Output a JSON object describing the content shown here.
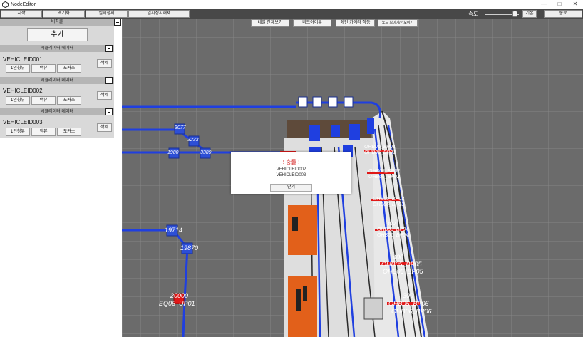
{
  "window": {
    "title": "NodeEditor",
    "controls": {
      "minimize": "—",
      "maximize": "□",
      "close": "✕"
    }
  },
  "menu": {
    "start": "시작",
    "reset": "초기화",
    "pause": "일시정지",
    "resume": "일시정지해제",
    "speed_label": "속도",
    "speed_level": 0.9,
    "default": "기본",
    "exit": "종료"
  },
  "left_panel": {
    "header": "비히클",
    "add": "추가",
    "vehicles": [
      {
        "section": "시뮬레이터 데이터",
        "id": "VEHICLEID001",
        "first_person": "1인칭뷰",
        "back_view": "백뷰",
        "focus": "포커스",
        "delete": "삭제"
      },
      {
        "section": "시뮬레이터 데이터",
        "id": "VEHICLEID002",
        "first_person": "1인칭뷰",
        "back_view": "백뷰",
        "focus": "포커스",
        "delete": "삭제"
      },
      {
        "section": "시뮬레이터 데이터",
        "id": "VEHICLEID003",
        "first_person": "1인칭뷰",
        "back_view": "백뷰",
        "focus": "포커스",
        "delete": "삭제"
      }
    ]
  },
  "viewport": {
    "rail_overview": "레일 전체보기",
    "bird_eye": "버드아이뷰",
    "main_camera": "메인 카메라 작동",
    "node_toggle": "노드 보이기/안보이기",
    "labels": {
      "n3077": "3077",
      "n3233": "3233",
      "n1980": "1980",
      "n3389": "3389",
      "n19714": "19714",
      "n19870": "19870",
      "n20000": "20000",
      "eq_up01": "EQ06_UP01",
      "bp01": "OHB06_BP01",
      "bp01b": "OHB06_BP01",
      "bp02": "OHB05_BP02",
      "bp02b": "OHB06_BP02",
      "bp03": "OHB05_BP03",
      "bp03b": "OHB06_BP03",
      "n400a": "400",
      "bp04": "OHB05_BP04",
      "bp04b": "OHB06_BP04",
      "n400b": "400",
      "bp05": "OHB05_BP05",
      "bp05b": "OHB06_BP05",
      "n300": "300",
      "bp06": "OHB05_BP06",
      "bp06b": "OHB06_BP06"
    },
    "colors": {
      "rail": "#1f3fe0",
      "node": "#2d4fd6",
      "collision": "#e01818",
      "floor": "#6e6e6e",
      "grid": "#8a8a8a",
      "orange": "#e2601a",
      "platform": "#d7d7d7"
    }
  },
  "dialog": {
    "title": "! 충돌 !",
    "lines": [
      "VEHICLEID002",
      "VEHICLEID003"
    ],
    "close": "닫기"
  }
}
